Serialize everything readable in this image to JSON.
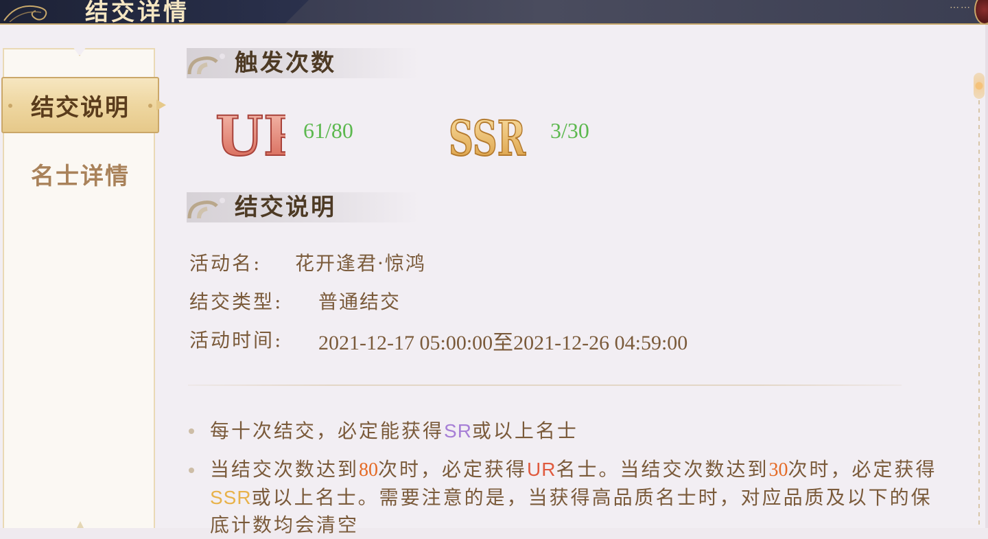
{
  "header": {
    "title": "结交详情",
    "dots": "⋯⋯"
  },
  "sidebar": {
    "tabs": [
      {
        "label": "结交说明",
        "active": true
      },
      {
        "label": "名士详情",
        "active": false
      }
    ]
  },
  "trigger_section": {
    "title": "触发次数",
    "counters": [
      {
        "rarity": "UR",
        "count": "61/80"
      },
      {
        "rarity": "SSR",
        "count": "3/30"
      }
    ]
  },
  "description_section": {
    "title": "结交说明",
    "rows": [
      {
        "label": "活动名:",
        "value": "花开逢君·惊鸿"
      },
      {
        "label": "结交类型:",
        "value": "普通结交"
      },
      {
        "label": "活动时间:",
        "value": "2021-12-17 05:00:00至2021-12-26 04:59:00"
      }
    ]
  },
  "rules": [
    {
      "segments": [
        "每十次结交，必定能获得",
        "SR",
        "或以上名士"
      ]
    },
    {
      "segments": [
        "当结交次数达到",
        "80",
        "次时，必定获得",
        "UR",
        "名士。当结交次数达到",
        "30",
        "次时，必定获得",
        "SSR",
        "或以上名士。需要注意的是，当获得高品质名士时，对应品质及以下的保底计数均会清空"
      ]
    }
  ],
  "colors": {
    "counter_green": "#5cb84e",
    "sr_purple": "#a77fd6",
    "ur_red": "#e05a3e",
    "number_orange": "#e46a25",
    "ssr_gold": "#e8b24a",
    "text_brown": "#7a5a3a"
  }
}
